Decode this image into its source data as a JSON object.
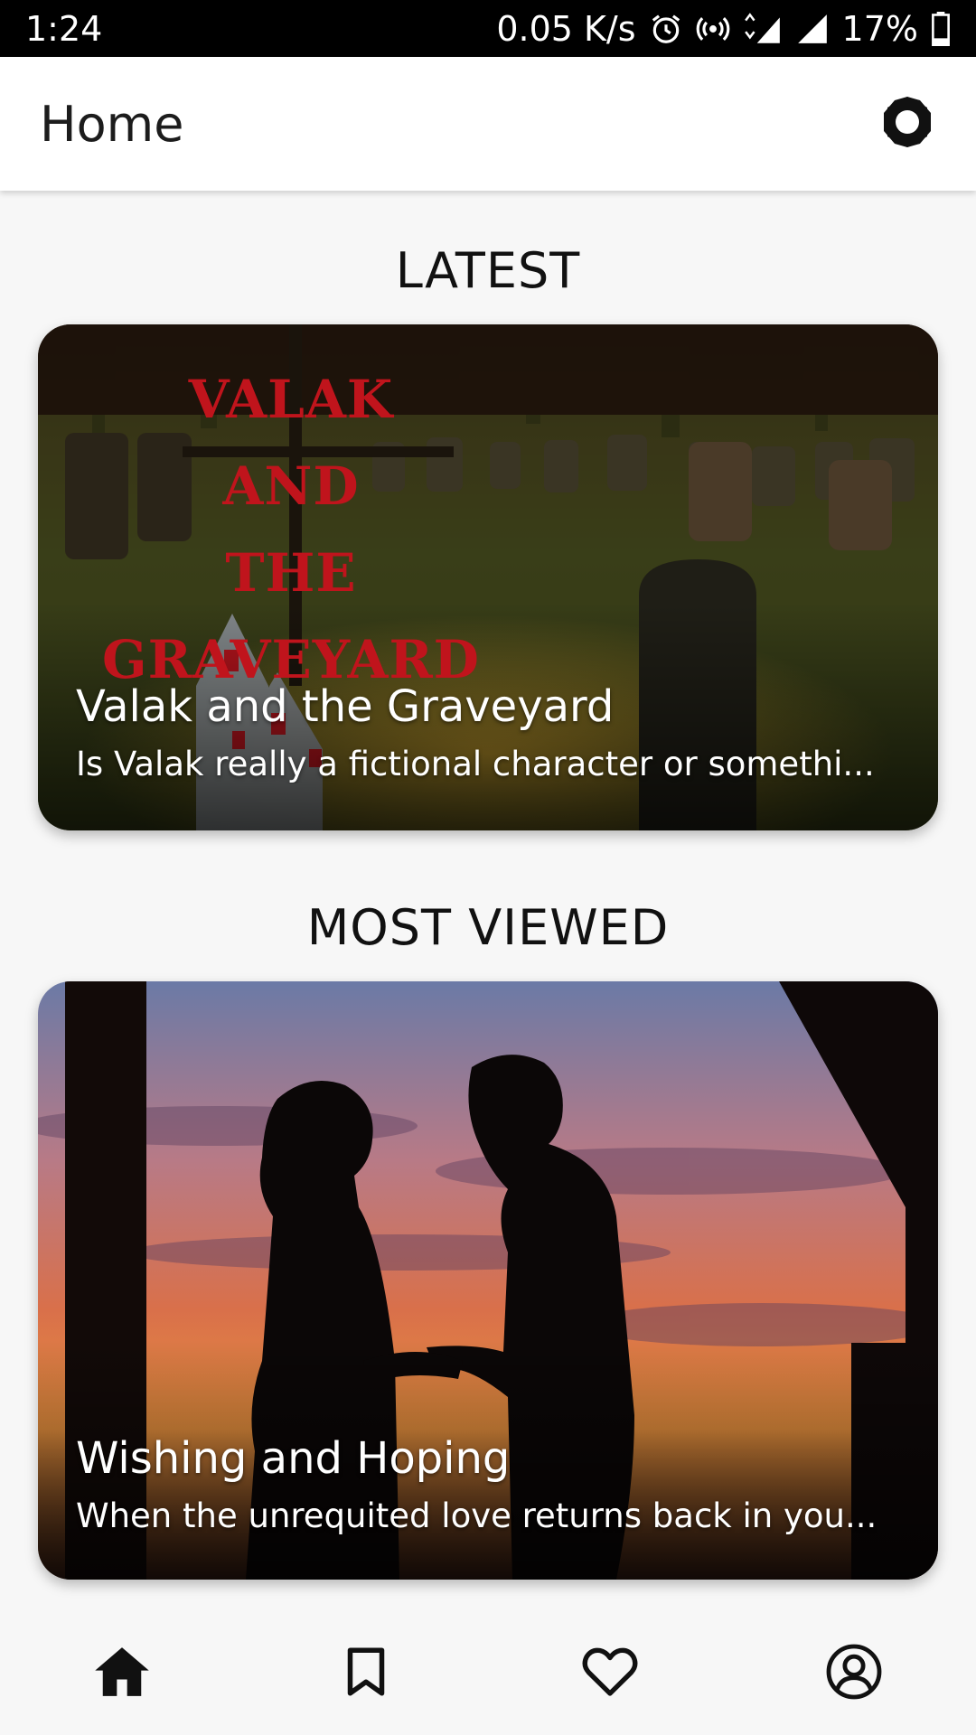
{
  "status_bar": {
    "time": "1:24",
    "net_speed": "0.05 K/s",
    "network_type": "4G",
    "battery": "17%"
  },
  "app_bar": {
    "title": "Home",
    "settings_icon": "gear-icon"
  },
  "sections": {
    "latest": {
      "heading": "LATEST",
      "card": {
        "title": "Valak and the Graveyard",
        "subtitle": "Is Valak really a fictional character or somethi...",
        "cover_text": [
          "VALAK",
          "AND",
          "THE GRAVEYARD"
        ],
        "cover_text_color": "#c0141c"
      }
    },
    "most_viewed": {
      "heading": "MOST VIEWED",
      "card": {
        "title": "Wishing and Hoping",
        "subtitle": "When the unrequited love returns back in you..."
      }
    }
  },
  "bottom_nav": {
    "items": [
      {
        "icon": "home-icon",
        "active": true
      },
      {
        "icon": "bookmark-icon",
        "active": false
      },
      {
        "icon": "heart-icon",
        "active": false
      },
      {
        "icon": "profile-icon",
        "active": false
      }
    ]
  }
}
